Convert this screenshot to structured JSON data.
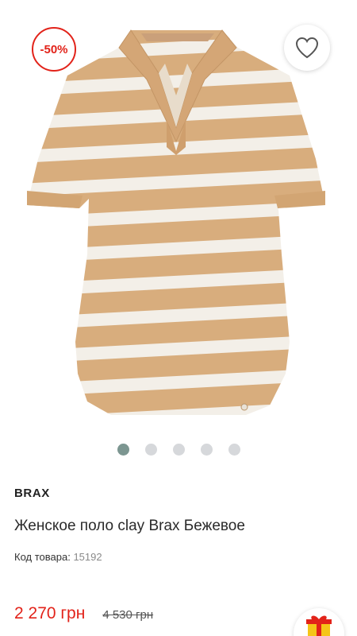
{
  "badge": {
    "discount": "-50%"
  },
  "product": {
    "brand": "BRAX",
    "title": "Женское поло clay Brax Бежевое",
    "code_label": "Код товара:",
    "code_value": "15192",
    "price_current": "2 270 грн",
    "price_old": "4 530 грн"
  },
  "gallery": {
    "image_count": 5,
    "active_index": 0,
    "stripe_colors": [
      "#d8ad7d",
      "#f3efe8"
    ],
    "garment_tag": "BRAX"
  },
  "colors": {
    "accent": "#e2231a",
    "dot_active": "#7c9691",
    "dot_inactive": "#d6d8db"
  },
  "icons": {
    "wishlist": "heart-icon",
    "gift": "gift-icon"
  }
}
